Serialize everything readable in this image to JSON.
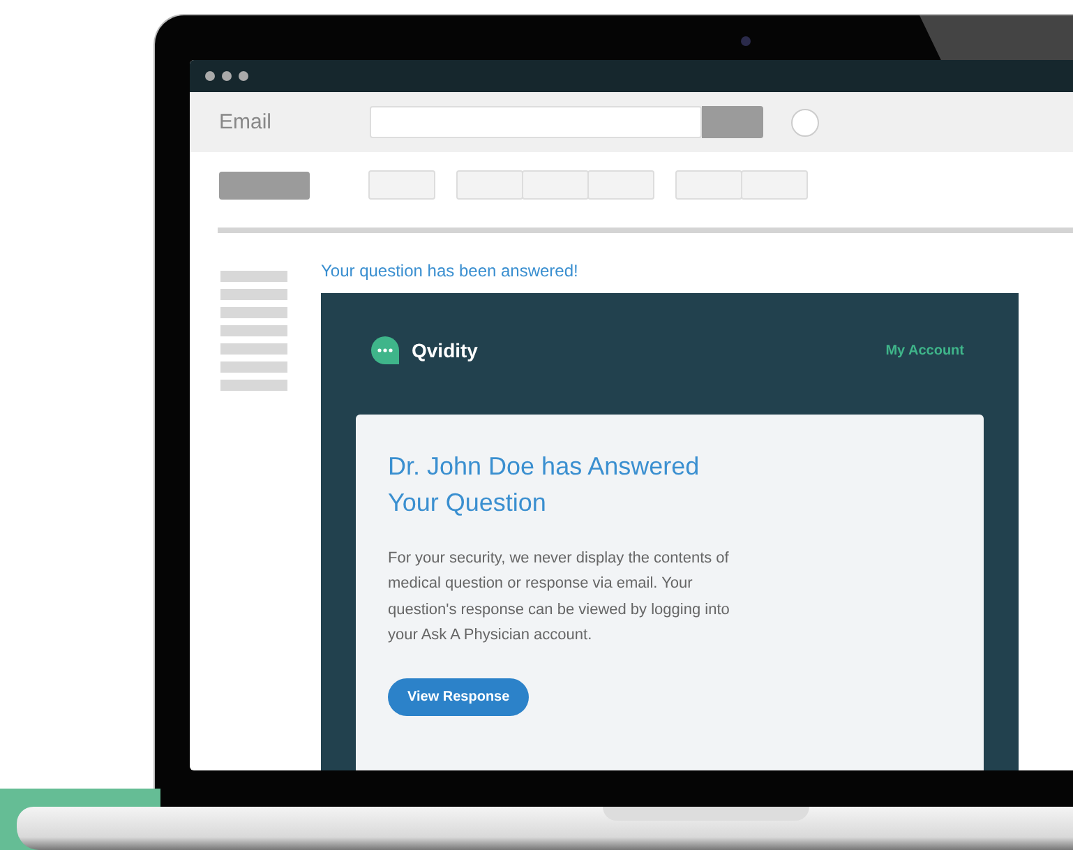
{
  "app": {
    "title": "Email"
  },
  "message": {
    "subject": "Your question has been answered!"
  },
  "email": {
    "brand": "Qvidity",
    "account_link": "My Account",
    "heading": "Dr. John Doe has Answered Your Question",
    "body": "For your security, we never display the contents of medical question or response via email. Your question's response can be viewed by logging into your Ask A Physician account.",
    "button": "View Response"
  }
}
